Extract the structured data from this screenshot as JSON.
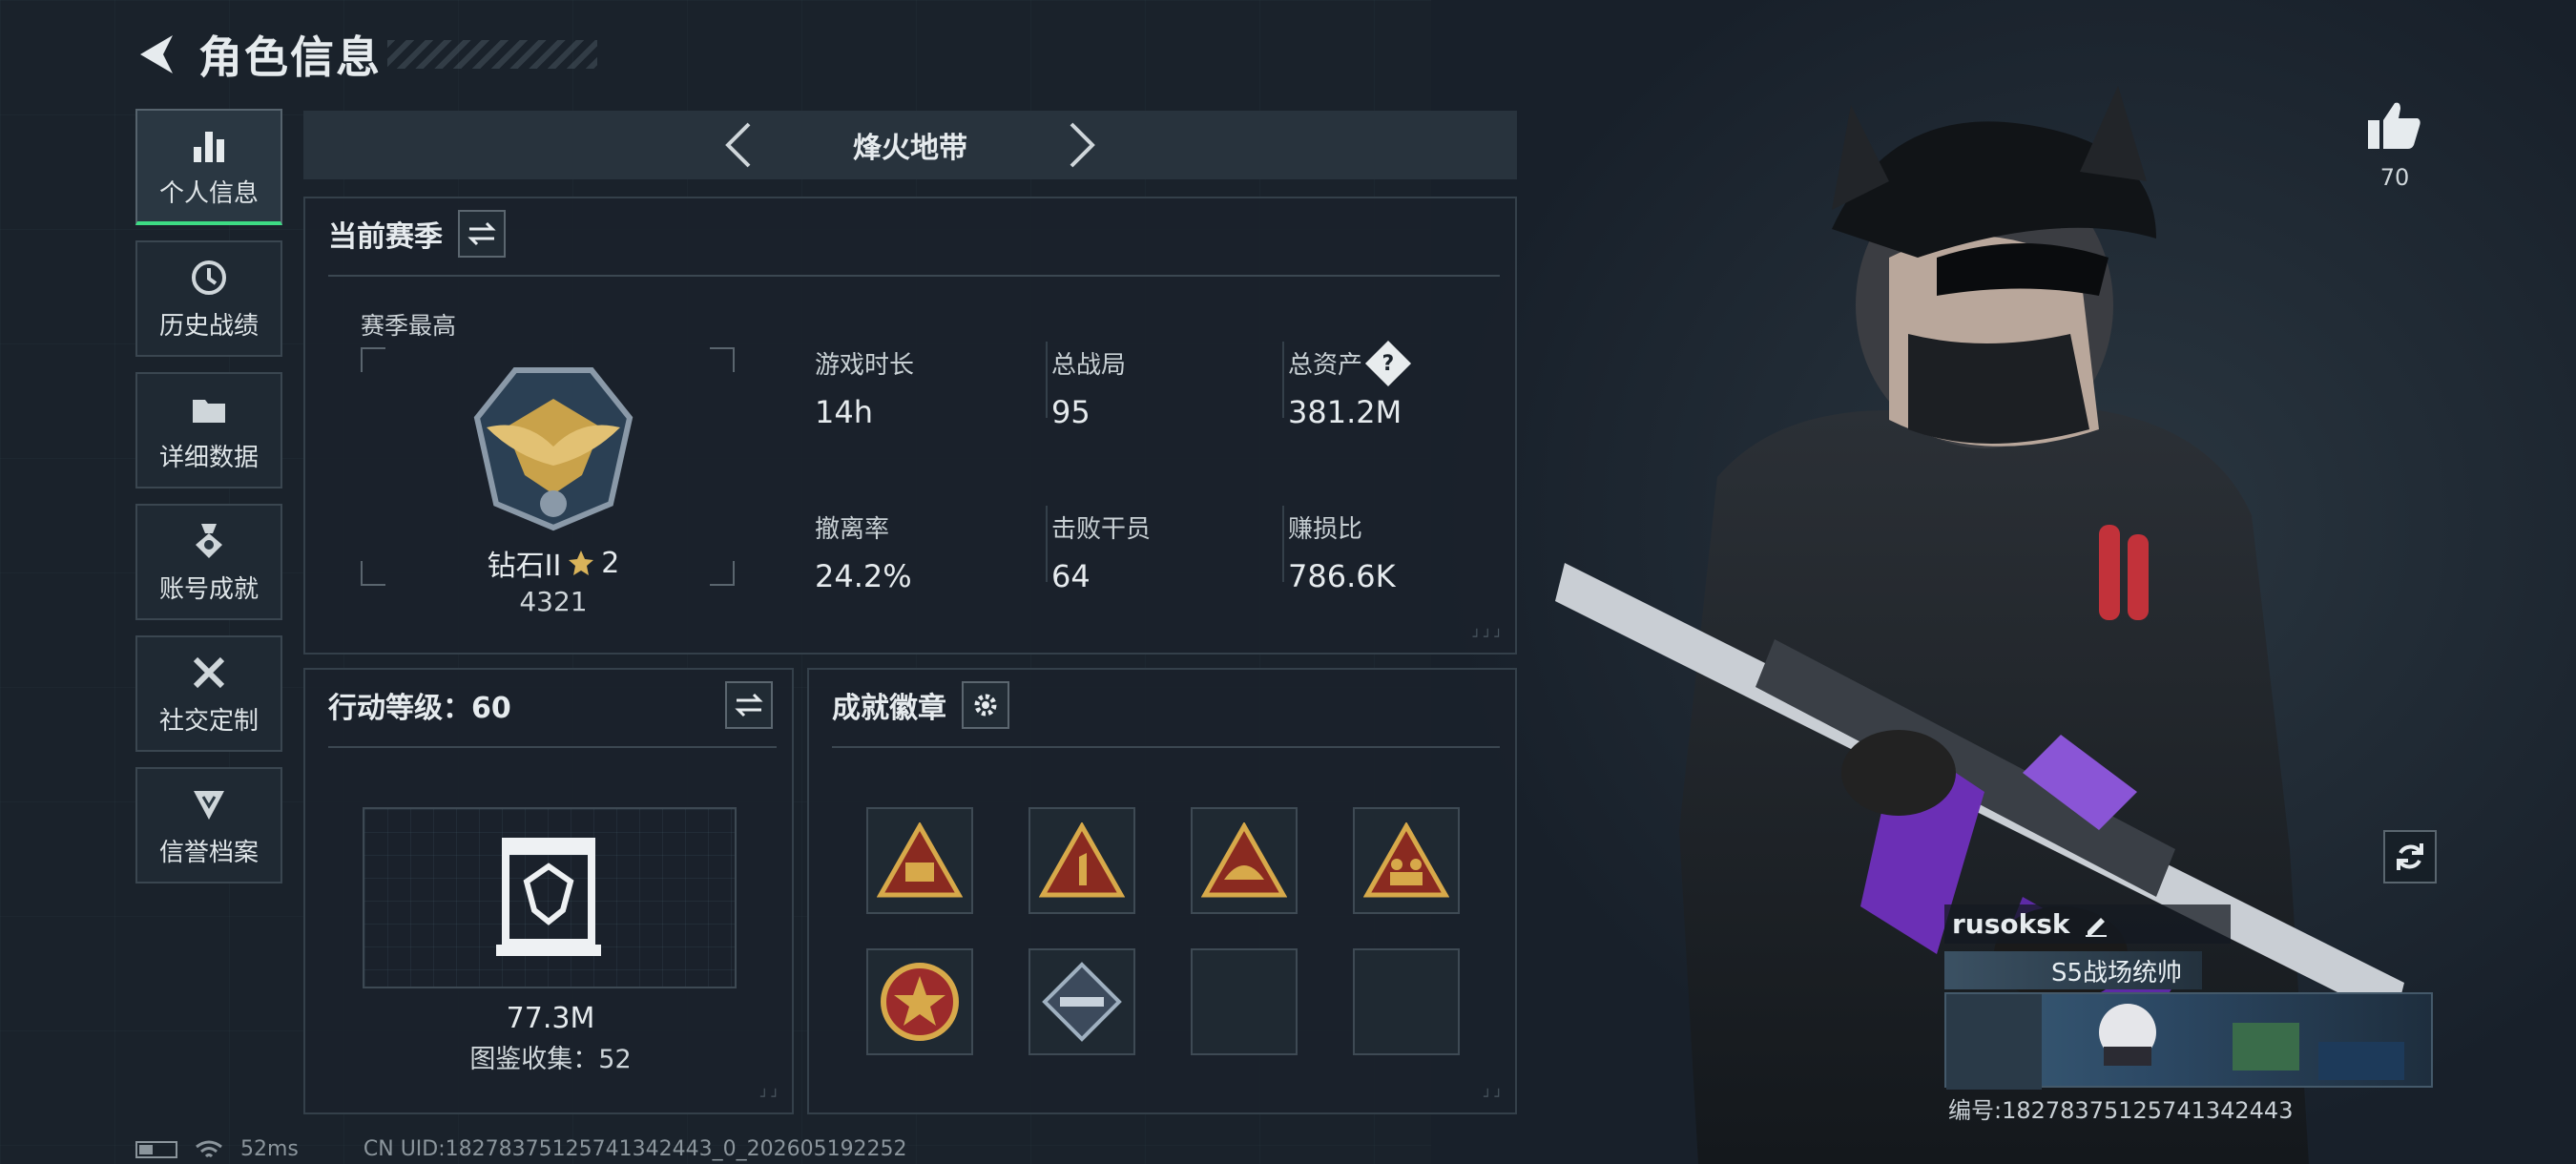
{
  "header": {
    "title": "角色信息"
  },
  "sidebar": {
    "items": [
      {
        "label": "个人信息",
        "icon": "bar-chart-icon",
        "active": true
      },
      {
        "label": "历史战绩",
        "icon": "history-icon"
      },
      {
        "label": "详细数据",
        "icon": "folder-icon"
      },
      {
        "label": "账号成就",
        "icon": "medal-icon"
      },
      {
        "label": "社交定制",
        "icon": "tools-icon"
      },
      {
        "label": "信誉档案",
        "icon": "credit-shield-icon"
      }
    ]
  },
  "map_selector": {
    "name": "烽火地带"
  },
  "season": {
    "title": "当前赛季",
    "best_label": "赛季最高",
    "rank": {
      "name": "钻石II",
      "stars": "2",
      "score": "4321"
    },
    "stats": [
      {
        "label": "游戏时长",
        "value": "14h"
      },
      {
        "label": "总战局",
        "value": "95"
      },
      {
        "label": "总资产",
        "value": "381.2M",
        "help": "?"
      },
      {
        "label": "撤离率",
        "value": "24.2%"
      },
      {
        "label": "击败干员",
        "value": "64"
      },
      {
        "label": "赚损比",
        "value": "786.6K"
      }
    ]
  },
  "level": {
    "title": "行动等级：60",
    "collection_value": "77.3M",
    "collection_count": "图鉴收集：52"
  },
  "badges": {
    "title": "成就徽章"
  },
  "like": {
    "count": "70"
  },
  "player": {
    "name": "rusoksk",
    "title": "S5战场统帅",
    "id": "编号:18278375125741342443"
  },
  "status": {
    "ping": "52ms",
    "uid": "CN UID:18278375125741342443_0_202605192252"
  },
  "colors": {
    "accent": "#3ddc84",
    "panel": "#1a222b"
  }
}
